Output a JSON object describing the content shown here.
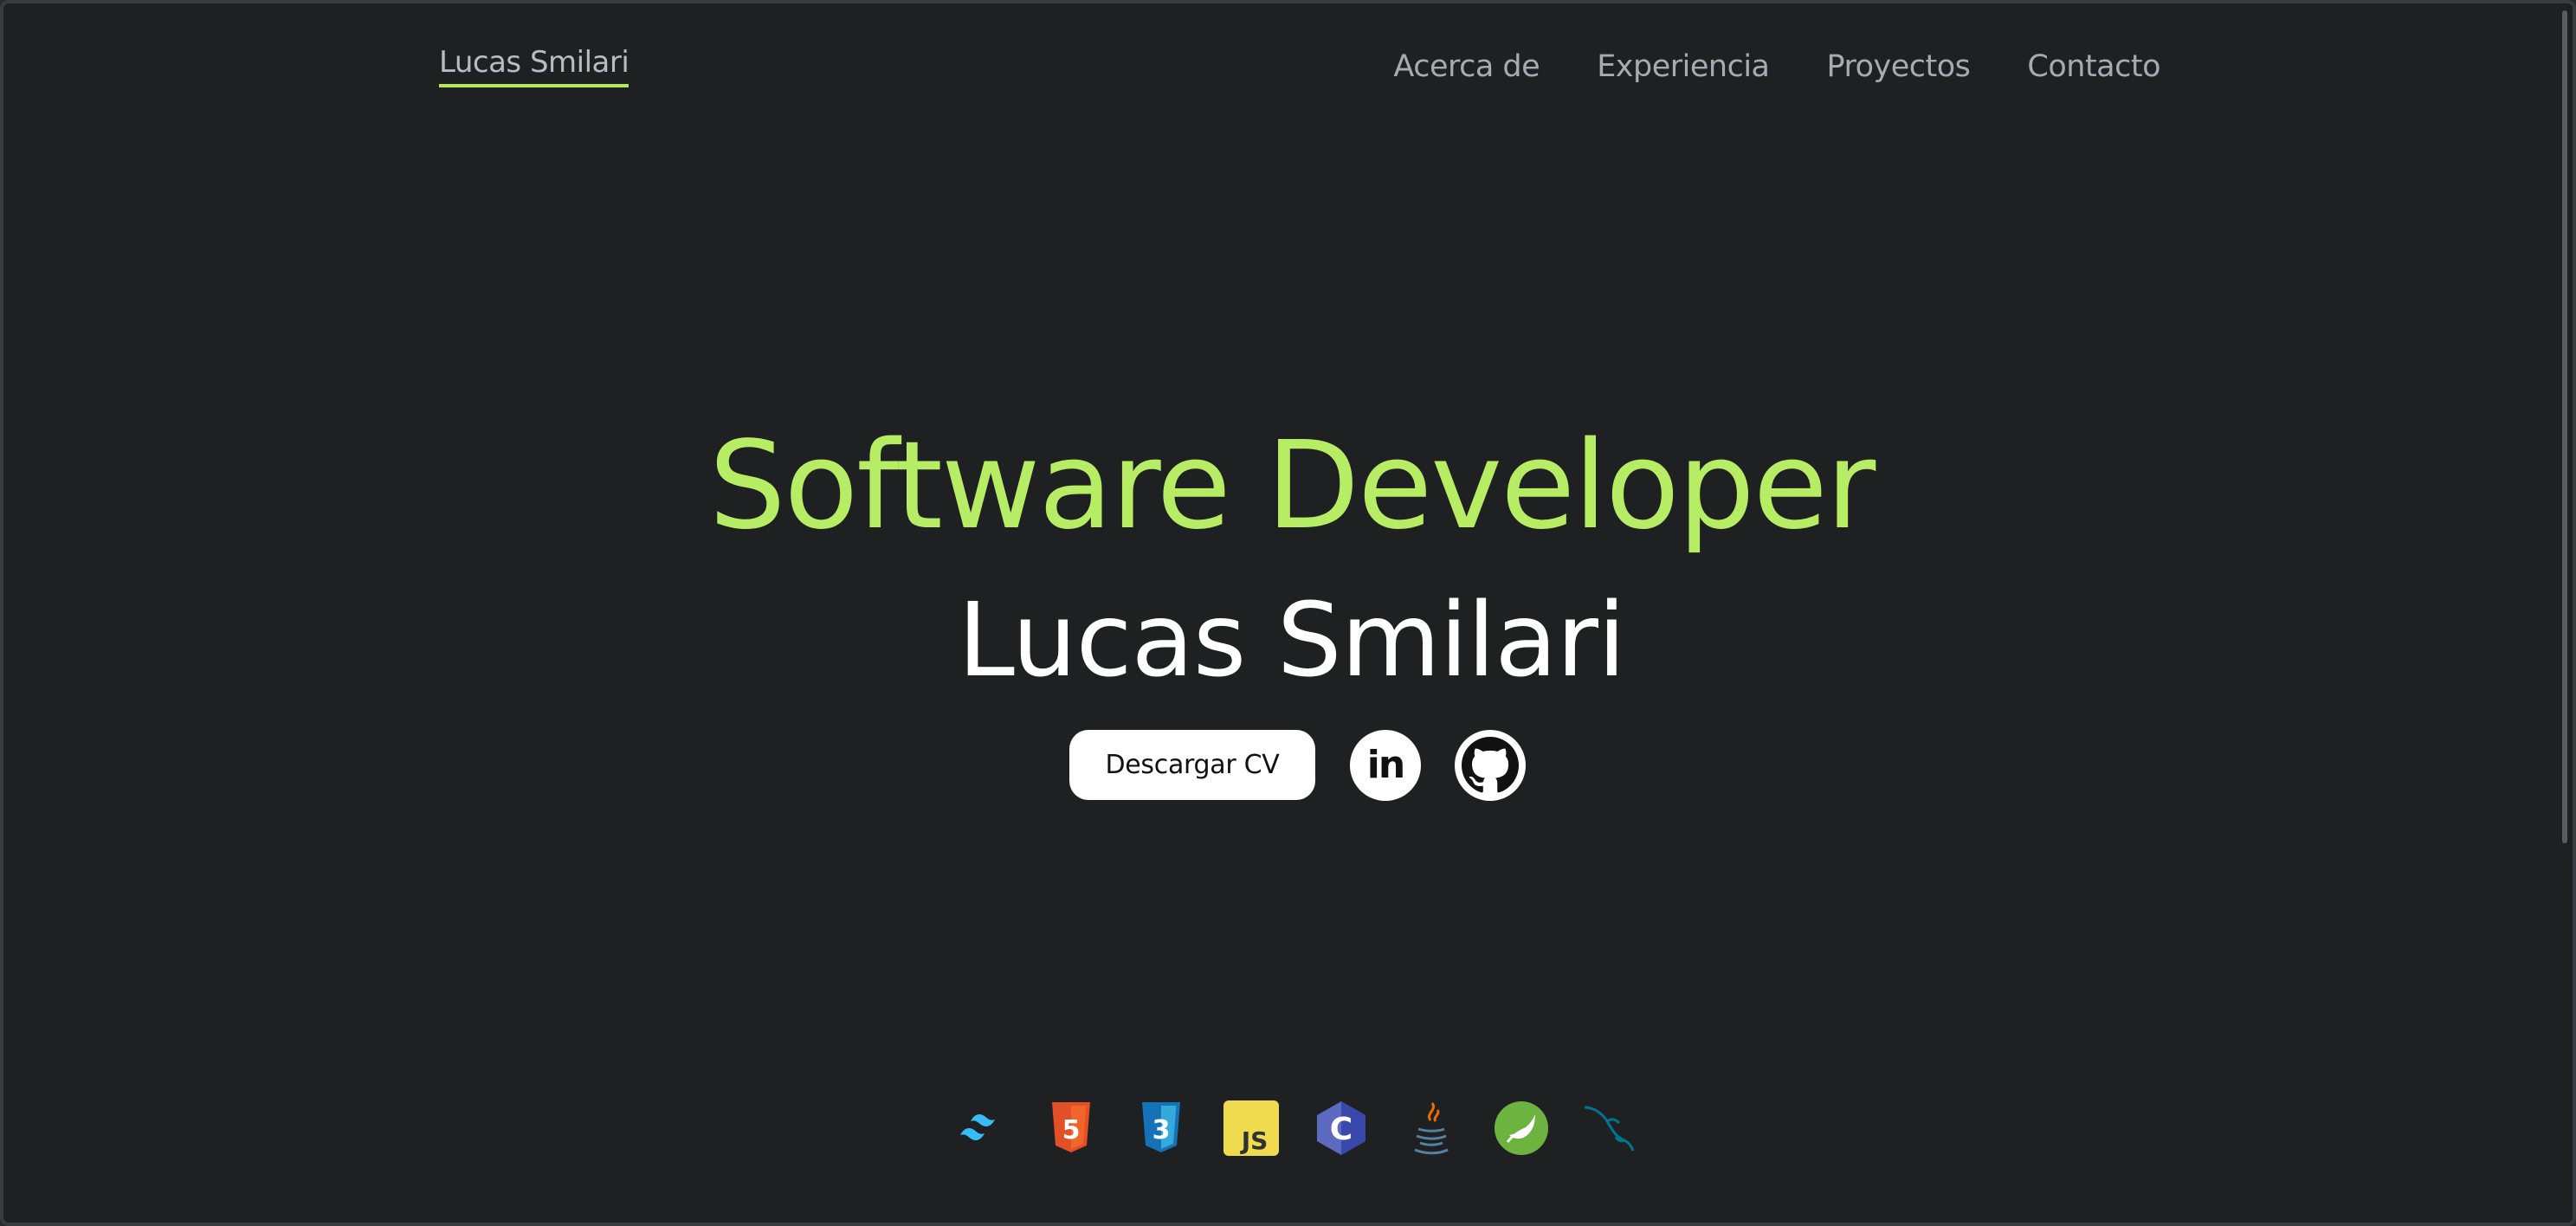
{
  "header": {
    "brand": "Lucas Smilari",
    "nav": [
      "Acerca de",
      "Experiencia",
      "Proyectos",
      "Contacto"
    ]
  },
  "hero": {
    "title": "Software Developer",
    "name": "Lucas Smilari",
    "cta_label": "Descargar CV",
    "social": [
      {
        "icon": "linkedin-icon",
        "label": "in"
      },
      {
        "icon": "github-icon"
      }
    ]
  },
  "tech_stack": [
    {
      "icon": "tailwind-icon",
      "color": "#38bdf8"
    },
    {
      "icon": "html5-icon",
      "color": "#e34f26",
      "label": "5"
    },
    {
      "icon": "css3-icon",
      "color": "#1572b6",
      "label": "3"
    },
    {
      "icon": "javascript-icon",
      "color": "#f0db4f",
      "label": "JS"
    },
    {
      "icon": "c-icon",
      "color": "#5c6bc0",
      "label": "C"
    },
    {
      "icon": "java-icon",
      "color": "#5382a1"
    },
    {
      "icon": "spring-icon",
      "color": "#6db33f"
    },
    {
      "icon": "mysql-icon",
      "color": "#00758f"
    }
  ],
  "colors": {
    "accent": "#b7ec65",
    "background": "#1f2022",
    "nav_text": "#a7abb1"
  }
}
